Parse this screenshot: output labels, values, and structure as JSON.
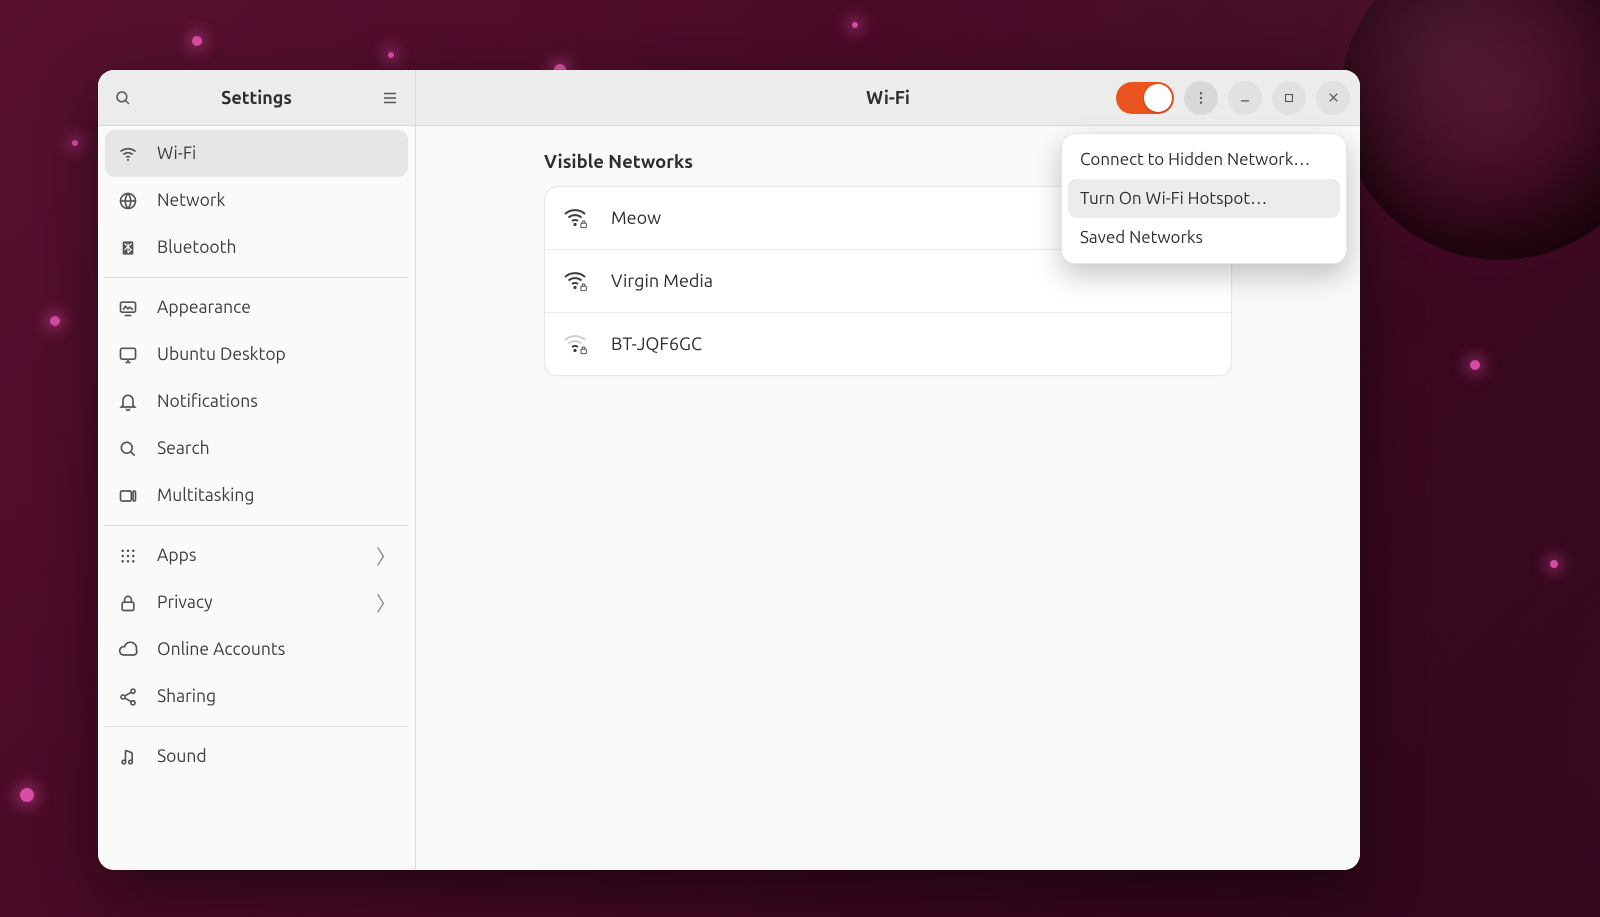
{
  "sidebar": {
    "title": "Settings",
    "groups": [
      [
        {
          "icon": "wifi",
          "label": "Wi-Fi",
          "selected": true
        },
        {
          "icon": "network",
          "label": "Network"
        },
        {
          "icon": "bluetooth",
          "label": "Bluetooth"
        }
      ],
      [
        {
          "icon": "appearance",
          "label": "Appearance"
        },
        {
          "icon": "desktop",
          "label": "Ubuntu Desktop"
        },
        {
          "icon": "bell",
          "label": "Notifications"
        },
        {
          "icon": "search",
          "label": "Search"
        },
        {
          "icon": "multitask",
          "label": "Multitasking"
        }
      ],
      [
        {
          "icon": "apps",
          "label": "Apps",
          "chevron": true
        },
        {
          "icon": "lock",
          "label": "Privacy",
          "chevron": true
        },
        {
          "icon": "cloud",
          "label": "Online Accounts"
        },
        {
          "icon": "share",
          "label": "Sharing"
        }
      ],
      [
        {
          "icon": "sound",
          "label": "Sound"
        }
      ]
    ]
  },
  "main": {
    "title": "Wi-Fi",
    "wifi_enabled": true,
    "section_label": "Visible Networks",
    "networks": [
      {
        "ssid": "Meow",
        "strength": "full",
        "secure": true
      },
      {
        "ssid": "Virgin Media",
        "strength": "full",
        "secure": true
      },
      {
        "ssid": "BT-JQF6GC",
        "strength": "weak",
        "secure": true
      }
    ],
    "popover": {
      "items": [
        {
          "label": "Connect to Hidden Network…",
          "hover": false
        },
        {
          "label": "Turn On Wi-Fi Hotspot…",
          "hover": true
        },
        {
          "label": "Saved Networks",
          "hover": false
        }
      ]
    }
  }
}
